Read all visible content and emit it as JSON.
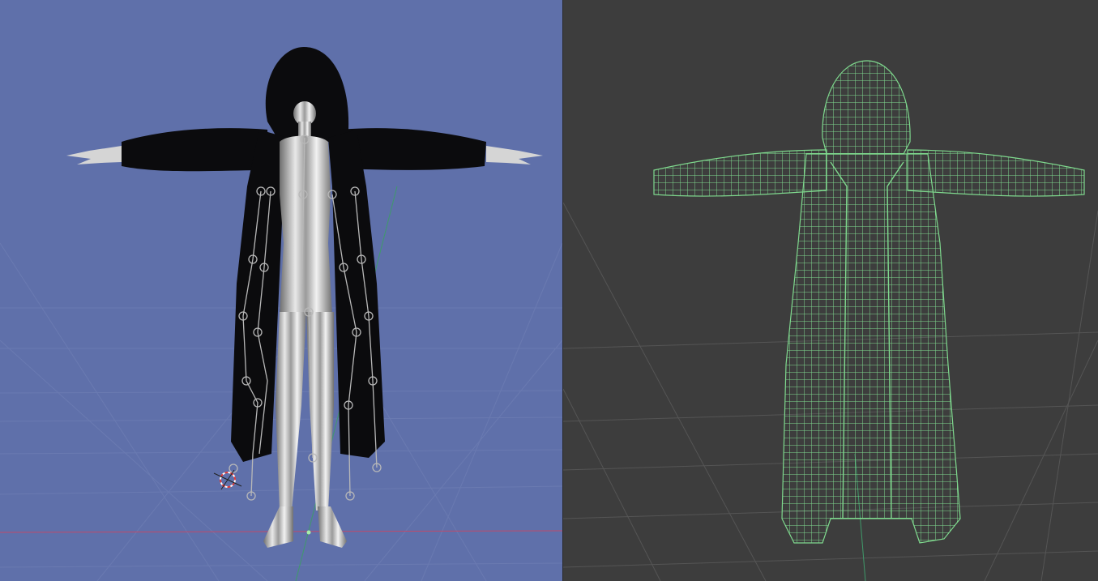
{
  "viewports": [
    {
      "id": "left",
      "shading": "material-preview",
      "background_color": "#5f70aa",
      "contents": [
        "hooded-long-coat",
        "chrome-mannequin",
        "armature-bones",
        "3d-cursor",
        "ground-grid"
      ]
    },
    {
      "id": "right",
      "shading": "wireframe",
      "background_color": "#3d3d3d",
      "wire_color": "#7fd98e",
      "contents": [
        "hooded-long-coat-wireframe",
        "ground-grid"
      ]
    }
  ],
  "colors": {
    "coat": "#0b0b0d",
    "mannequin": "#c8c8c8",
    "bones": "#b8b8b8",
    "x_axis": "#c04a6a",
    "y_axis": "#3f9a6a",
    "cursor": "#e03a3a"
  }
}
